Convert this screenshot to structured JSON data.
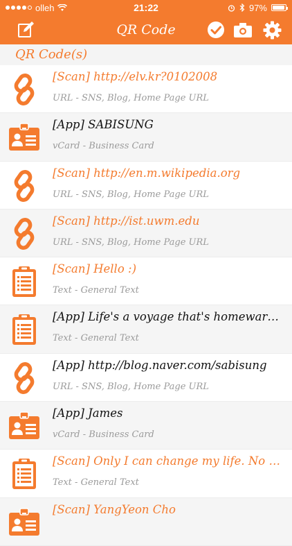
{
  "status_bar": {
    "carrier": "olleh",
    "time": "21:22",
    "battery": "97%",
    "battery_level": 0.97
  },
  "nav": {
    "title": "QR Code",
    "left_icon": "edit-icon",
    "right_icons": [
      "check-icon",
      "camera-icon",
      "gear-icon"
    ]
  },
  "section": {
    "header": "QR Code(s)"
  },
  "items": [
    {
      "title": "[Scan] http://elv.kr?0102008",
      "subtitle": "URL - SNS, Blog, Home Page URL",
      "icon": "link-icon",
      "kind": "scan"
    },
    {
      "title": "[App] SABISUNG",
      "subtitle": "vCard - Business Card",
      "icon": "id-card-icon",
      "kind": "app"
    },
    {
      "title": "[Scan] http://en.m.wikipedia.org",
      "subtitle": "URL - SNS, Blog, Home Page URL",
      "icon": "link-icon",
      "kind": "scan"
    },
    {
      "title": "[Scan] http://ist.uwm.edu",
      "subtitle": "URL - SNS, Blog, Home Page URL",
      "icon": "link-icon",
      "kind": "scan"
    },
    {
      "title": "[Scan] Hello :)",
      "subtitle": "Text - General Text",
      "icon": "clipboard-icon",
      "kind": "scan"
    },
    {
      "title": "[App] Life's a voyage that's homeward…",
      "subtitle": "Text - General Text",
      "icon": "clipboard-icon",
      "kind": "app"
    },
    {
      "title": "[App] http://blog.naver.com/sabisung",
      "subtitle": "URL - SNS, Blog, Home Page URL",
      "icon": "link-icon",
      "kind": "app"
    },
    {
      "title": "[App] James",
      "subtitle": "vCard - Business Card",
      "icon": "id-card-icon",
      "kind": "app"
    },
    {
      "title": "[Scan] Only I can change my life. No o…",
      "subtitle": "Text - General Text",
      "icon": "clipboard-icon",
      "kind": "scan"
    },
    {
      "title": "[Scan] YangYeon Cho",
      "subtitle": "",
      "icon": "id-card-icon",
      "kind": "scan"
    }
  ],
  "colors": {
    "accent": "#f47b2e",
    "alt_row": "#f5f5f5",
    "subtitle": "#9a9a9a"
  }
}
